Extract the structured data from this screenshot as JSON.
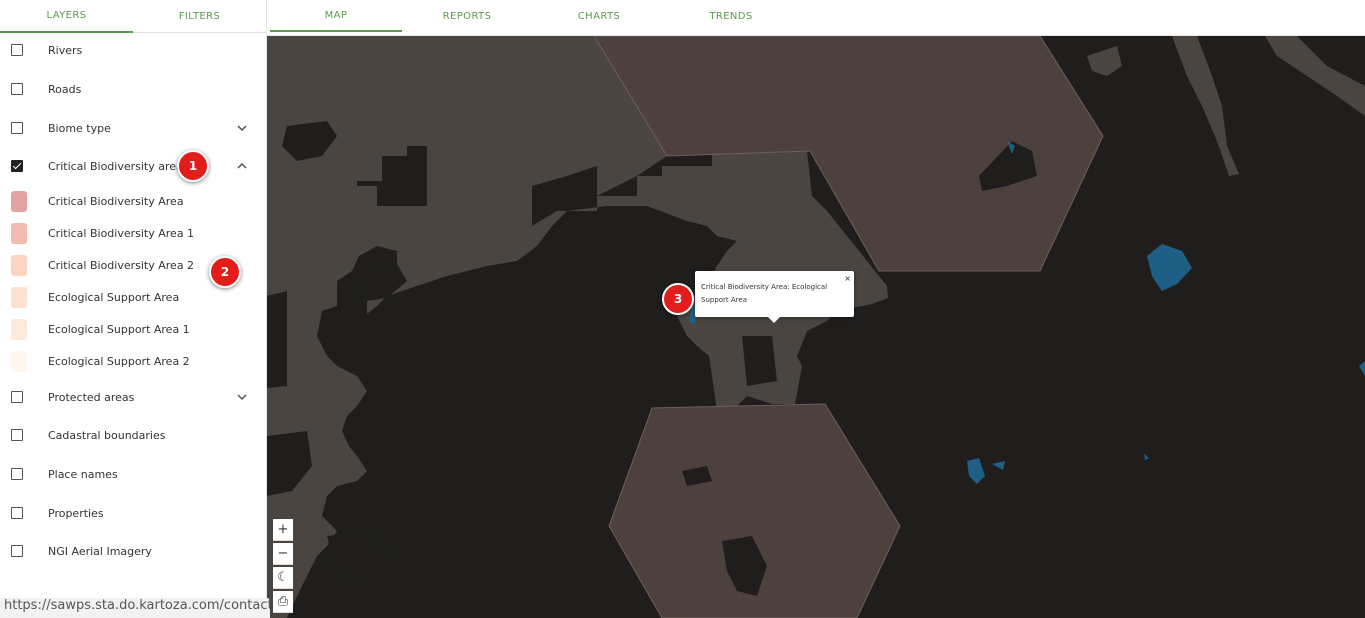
{
  "sidebar": {
    "tabs": [
      {
        "label": "LAYERS",
        "active": true
      },
      {
        "label": "FILTERS",
        "active": false
      }
    ],
    "layers_top": [
      {
        "label": "Rivers",
        "checked": false
      },
      {
        "label": "Roads",
        "checked": false
      },
      {
        "label": "Biome type",
        "checked": false,
        "expand": "chevron-down-icon"
      },
      {
        "label": "Critical Biodiversity areas",
        "checked": true,
        "expand": "chevron-up-icon"
      }
    ],
    "legend": [
      {
        "label": "Critical Biodiversity Area",
        "color": "#e3a3a3"
      },
      {
        "label": "Critical Biodiversity Area 1",
        "color": "#f2bcb0"
      },
      {
        "label": "Critical Biodiversity Area 2",
        "color": "#fbd3bf"
      },
      {
        "label": "Ecological Support Area",
        "color": "#fde0cd"
      },
      {
        "label": "Ecological Support Area 1",
        "color": "#feeadb"
      },
      {
        "label": "Ecological Support Area 2",
        "color": "#fff6ee"
      }
    ],
    "layers_bottom": [
      {
        "label": "Protected areas",
        "checked": false,
        "expand": "chevron-down-icon"
      },
      {
        "label": "Cadastral boundaries",
        "checked": false
      },
      {
        "label": "Place names",
        "checked": false
      },
      {
        "label": "Properties",
        "checked": false
      },
      {
        "label": "NGI Aerial Imagery",
        "checked": false
      }
    ]
  },
  "topbar": {
    "tabs": [
      {
        "label": "MAP",
        "active": true
      },
      {
        "label": "REPORTS",
        "active": false
      },
      {
        "label": "CHARTS",
        "active": false
      },
      {
        "label": "TRENDS",
        "active": false
      }
    ]
  },
  "map": {
    "popup": {
      "text": "Critical Biodiversity Area: Ecological Support Area",
      "close": "×"
    },
    "controls": [
      {
        "name": "zoom-in-button",
        "glyph": "+"
      },
      {
        "name": "zoom-out-button",
        "glyph": "−"
      },
      {
        "name": "dark-mode-button",
        "glyph": "☾"
      },
      {
        "name": "print-button",
        "glyph": "⎙"
      }
    ],
    "colors": {
      "background": "#1f1e1d",
      "cba_area": "#4a4541",
      "hexagon": "#4d413e",
      "water": "#1f5f86"
    }
  },
  "annotations": [
    {
      "number": "1"
    },
    {
      "number": "2"
    },
    {
      "number": "3"
    }
  ],
  "status_url": "https://sawps.sta.do.kartoza.com/contact"
}
